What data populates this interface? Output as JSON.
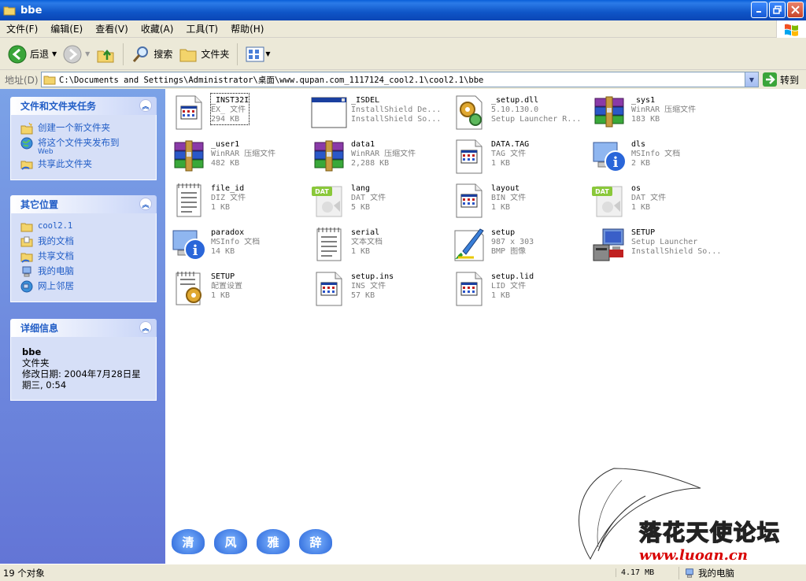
{
  "window": {
    "title": "bbe"
  },
  "menu": [
    "文件(F)",
    "编辑(E)",
    "查看(V)",
    "收藏(A)",
    "工具(T)",
    "帮助(H)"
  ],
  "toolbar": {
    "back": "后退",
    "search": "搜索",
    "folders": "文件夹"
  },
  "address": {
    "label": "地址(D)",
    "path": "C:\\Documents and Settings\\Administrator\\桌面\\www.qupan.com_1117124_cool2.1\\cool2.1\\bbe",
    "go": "转到"
  },
  "tasks": {
    "title": "文件和文件夹任务",
    "items": [
      {
        "label": "创建一个新文件夹",
        "icon": "new-folder-icon"
      },
      {
        "label": "将这个文件夹发布到",
        "sub": "Web",
        "icon": "publish-web-icon"
      },
      {
        "label": "共享此文件夹",
        "icon": "share-folder-icon"
      }
    ]
  },
  "places": {
    "title": "其它位置",
    "items": [
      {
        "label": "cool2.1",
        "icon": "folder-icon"
      },
      {
        "label": "我的文档",
        "icon": "my-documents-icon"
      },
      {
        "label": "共享文档",
        "icon": "shared-documents-icon"
      },
      {
        "label": "我的电脑",
        "icon": "my-computer-icon"
      },
      {
        "label": "网上邻居",
        "icon": "network-places-icon"
      }
    ]
  },
  "details": {
    "title": "详细信息",
    "name": "bbe",
    "type": "文件夹",
    "modified": "修改日期: 2004年7月28日星期三, 0:54"
  },
  "files": [
    {
      "name": "_INST32I",
      "type": "EX_ 文件",
      "size": "294 KB",
      "icon": "generic-file-icon",
      "selected": true
    },
    {
      "name": "_ISDEL",
      "type": "InstallShield De...",
      "size": "InstallShield So...",
      "icon": "application-window-icon"
    },
    {
      "name": "_setup.dll",
      "type": "5.10.130.0",
      "size": "Setup Launcher R...",
      "icon": "dll-gear-icon"
    },
    {
      "name": "_sys1",
      "type": "WinRAR 压缩文件",
      "size": "183 KB",
      "icon": "winrar-icon"
    },
    {
      "name": "_user1",
      "type": "WinRAR 压缩文件",
      "size": "482 KB",
      "icon": "winrar-icon"
    },
    {
      "name": "data1",
      "type": "WinRAR 压缩文件",
      "size": "2,288 KB",
      "icon": "winrar-icon"
    },
    {
      "name": "DATA.TAG",
      "type": "TAG 文件",
      "size": "1 KB",
      "icon": "generic-file-icon"
    },
    {
      "name": "dls",
      "type": "MSInfo 文档",
      "size": "2 KB",
      "icon": "msinfo-icon"
    },
    {
      "name": "file_id",
      "type": "DIZ 文件",
      "size": "1 KB",
      "icon": "text-file-icon"
    },
    {
      "name": "lang",
      "type": "DAT 文件",
      "size": "5 KB",
      "icon": "dat-file-icon"
    },
    {
      "name": "layout",
      "type": "BIN 文件",
      "size": "1 KB",
      "icon": "generic-file-icon"
    },
    {
      "name": "os",
      "type": "DAT 文件",
      "size": "1 KB",
      "icon": "dat-file-icon"
    },
    {
      "name": "paradox",
      "type": "MSInfo 文档",
      "size": "14 KB",
      "icon": "msinfo-icon"
    },
    {
      "name": "serial",
      "type": "文本文档",
      "size": "1 KB",
      "icon": "text-file-icon"
    },
    {
      "name": "setup",
      "type": "987 x 303",
      "size": "BMP 图像",
      "icon": "bmp-paint-icon"
    },
    {
      "name": "SETUP",
      "type": "Setup Launcher",
      "size": "InstallShield So...",
      "icon": "setup-computer-icon"
    },
    {
      "name": "SETUP",
      "type": "配置设置",
      "size": "1 KB",
      "icon": "config-settings-icon"
    },
    {
      "name": "setup.ins",
      "type": "INS 文件",
      "size": "57 KB",
      "icon": "generic-file-icon"
    },
    {
      "name": "setup.lid",
      "type": "LID 文件",
      "size": "1 KB",
      "icon": "generic-file-icon"
    }
  ],
  "status": {
    "count": "19 个对象",
    "size": "4.17 MB",
    "zone": "我的电脑"
  },
  "watermark": {
    "hearts": [
      "清",
      "风",
      "雅",
      "辞"
    ],
    "brand": "落花天使论坛",
    "url": "www.luoan.cn"
  }
}
